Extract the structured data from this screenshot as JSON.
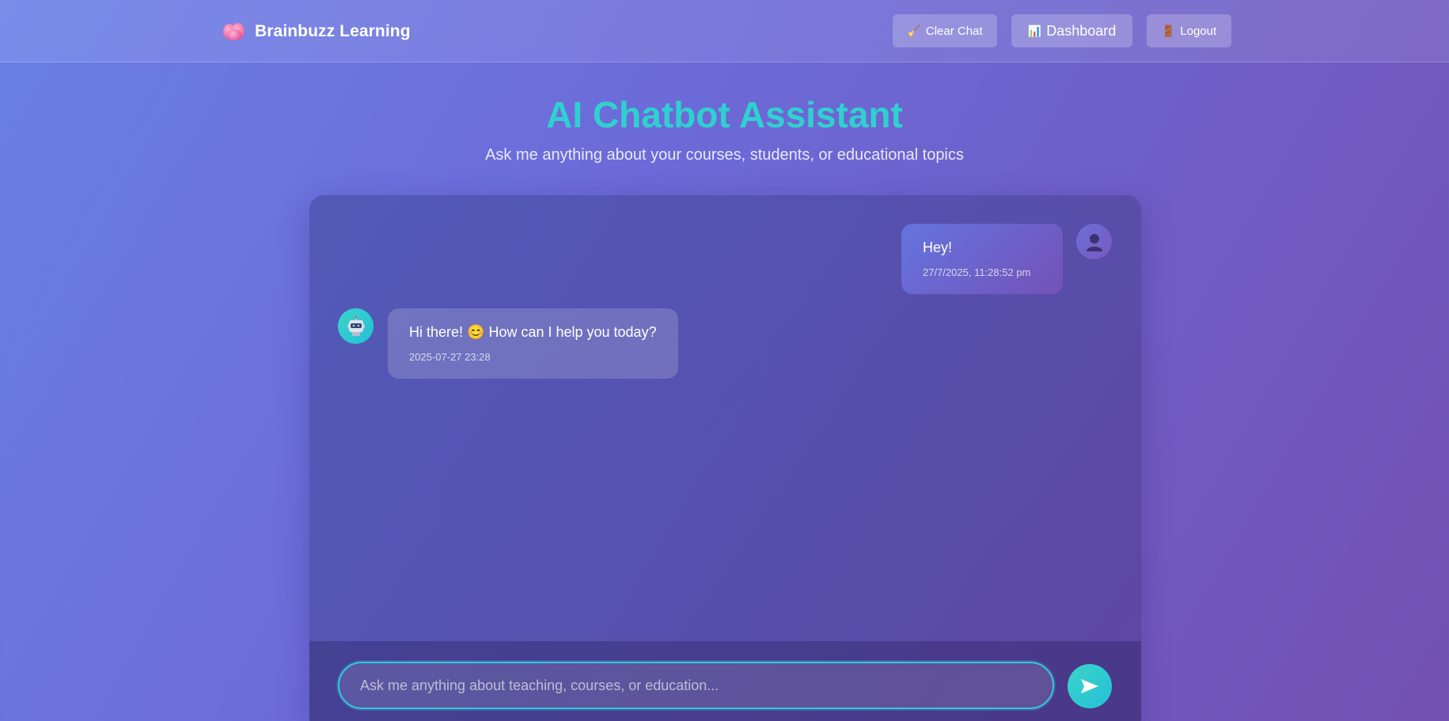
{
  "header": {
    "brand_icon": "brain-icon",
    "brand_title": "Brainbuzz Learning",
    "buttons": [
      {
        "icon": "broom-icon",
        "icon_glyph": "🧹",
        "label": "Clear Chat"
      },
      {
        "icon": "bar-chart-icon",
        "icon_glyph": "📊",
        "label": "Dashboard"
      },
      {
        "icon": "door-icon",
        "icon_glyph": "🚪",
        "label": "Logout"
      }
    ]
  },
  "page": {
    "title": "AI Chatbot Assistant",
    "subtitle": "Ask me anything about your courses, students, or educational topics"
  },
  "messages": [
    {
      "sender": "user",
      "avatar_icon": "user-silhouette-icon",
      "text": "Hey!",
      "time": "27/7/2025, 11:28:52 pm"
    },
    {
      "sender": "bot",
      "avatar_icon": "robot-icon",
      "text": "Hi there! 😊 How can I help you today?",
      "time": "2025-07-27 23:28"
    }
  ],
  "composer": {
    "placeholder": "Ask me anything about teaching, courses, or education...",
    "value": "",
    "send_icon": "send-arrow-icon"
  },
  "colors": {
    "accent": "#2fd1cf",
    "input_border": "#34c8dc",
    "brand_icon": "#e8609f"
  }
}
